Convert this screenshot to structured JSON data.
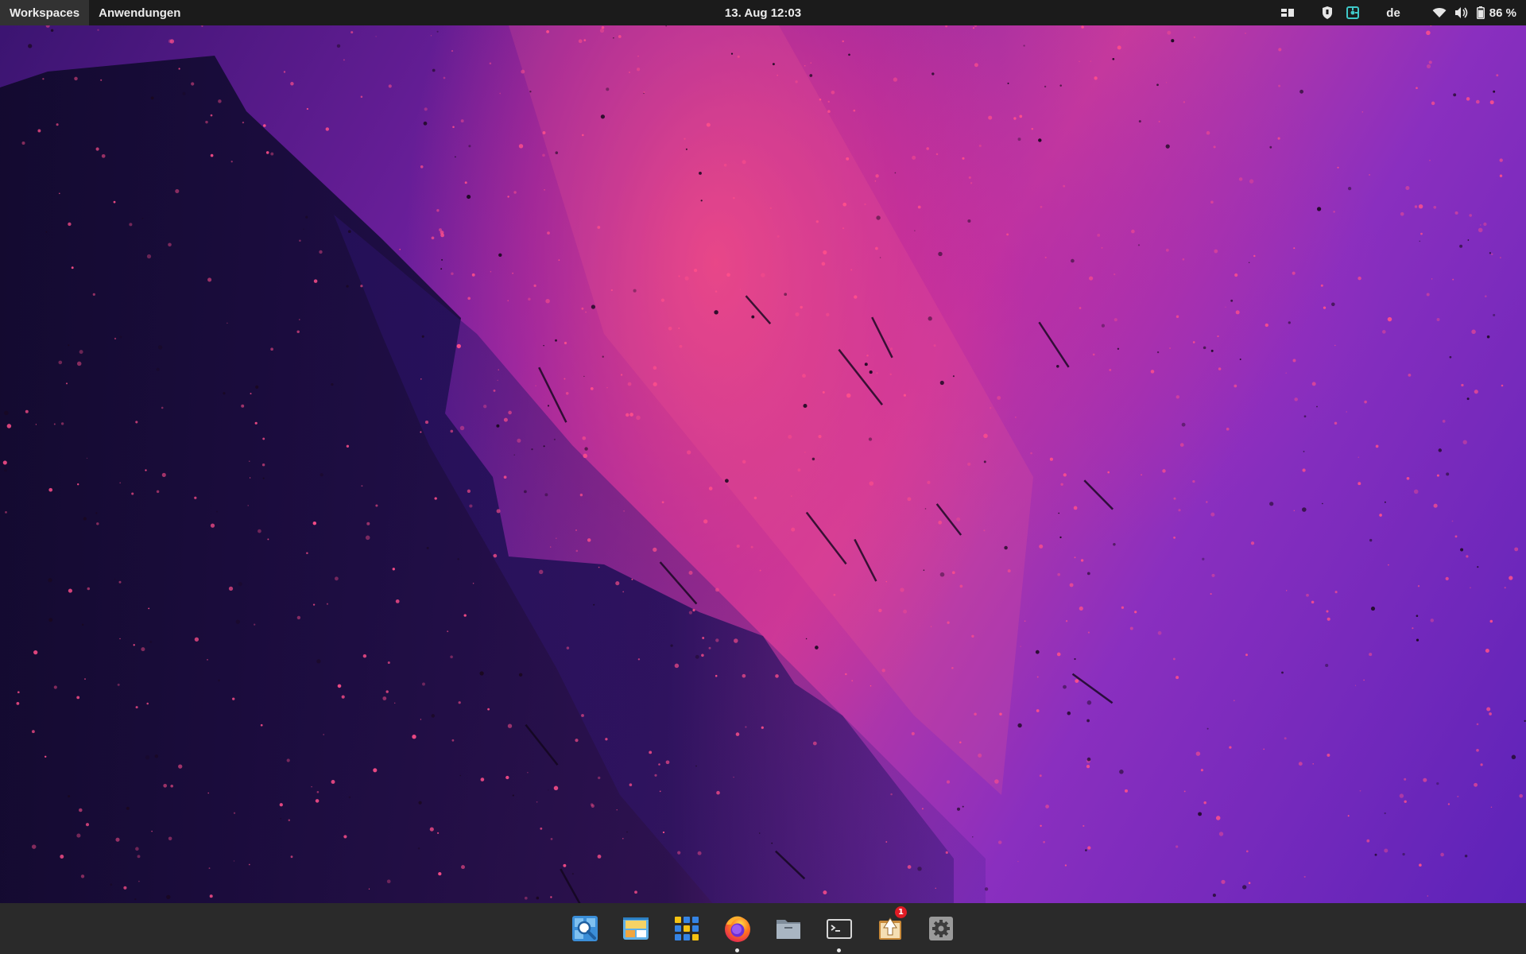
{
  "topbar": {
    "workspaces_label": "Workspaces",
    "applications_label": "Anwendungen",
    "clock": "13. Aug  12:03",
    "keyboard_layout": "de",
    "battery_percent": "86 %",
    "battery_level": 86
  },
  "dock": {
    "items": [
      {
        "icon": "search-icon",
        "running": false
      },
      {
        "icon": "screenshot-icon",
        "running": false
      },
      {
        "icon": "app-grid-icon",
        "running": false
      },
      {
        "icon": "firefox-icon",
        "running": true
      },
      {
        "icon": "files-icon",
        "running": false
      },
      {
        "icon": "terminal-icon",
        "running": true
      },
      {
        "icon": "software-updates-icon",
        "running": false,
        "badge": "1"
      },
      {
        "icon": "settings-icon",
        "running": false
      }
    ]
  },
  "colors": {
    "topbar_bg": "#1b1b1b",
    "dock_bg": "#2a2a2a",
    "badge": "#e01b24",
    "wallpaper_pink": "#e8468a",
    "wallpaper_purple": "#6a24b8"
  }
}
